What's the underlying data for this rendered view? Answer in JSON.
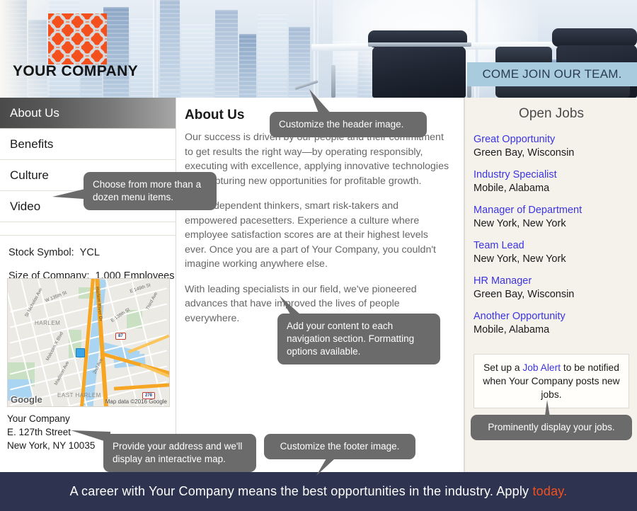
{
  "header": {
    "logo_alt": "company-logo",
    "company_name": "YOUR COMPANY",
    "banner_text": "COME JOIN OUR TEAM."
  },
  "sidebar": {
    "nav": [
      {
        "label": "About Us",
        "active": true
      },
      {
        "label": "Benefits",
        "active": false
      },
      {
        "label": "Culture",
        "active": false
      },
      {
        "label": "Video",
        "active": false
      }
    ],
    "facts": [
      {
        "label": "Stock Symbol:",
        "value": "YCL"
      },
      {
        "label": "Size of Company:",
        "value": "1,000 Employees"
      }
    ],
    "map": {
      "watermark": "Google",
      "attribution": "Map data ©2016 Google",
      "labels": [
        "St Nicholas Ave",
        "W 135th St",
        "HARLEM",
        "Malcolm X Blvd",
        "Madison Ave",
        "2nd Ave",
        "Harlem River Dr",
        "E 149th St",
        "Third Ave",
        "E 138th St",
        "EAST HARLEM"
      ],
      "shields": [
        "87",
        "278"
      ]
    },
    "address": {
      "line1": "Your Company",
      "line2": "E. 127th Street",
      "line3": "New York, NY 10035"
    }
  },
  "main": {
    "title": "About Us",
    "paragraphs": [
      "Our success is driven by our people and their commitment to get results the right way—by operating responsibly, executing with excellence, applying innovative technologies and capturing new opportunities for profitable growth.",
      "Join independent thinkers, smart risk-takers and empowered pacesetters. Experience a culture where employee satisfaction scores are at their highest levels ever. Once you are a part of Your Company, you couldn't imagine working anywhere else.",
      "With leading specialists in our field, we've pioneered advances that have improved the lives of people everywhere."
    ]
  },
  "jobs_panel": {
    "title": "Open Jobs",
    "jobs": [
      {
        "title": "Great Opportunity",
        "location": "Green Bay, Wisconsin"
      },
      {
        "title": "Industry Specialist",
        "location": "Mobile, Alabama"
      },
      {
        "title": "Manager of Department",
        "location": "New York, New York"
      },
      {
        "title": "Team Lead",
        "location": "New York, New York"
      },
      {
        "title": "HR Manager",
        "location": "Green Bay, Wisconsin"
      },
      {
        "title": "Another Opportunity",
        "location": "Mobile, Alabama"
      }
    ],
    "alert": {
      "prefix": "Set up a ",
      "link": "Job Alert",
      "suffix": " to be notified when Your Company posts new jobs."
    }
  },
  "callouts": [
    {
      "id": "header-image",
      "text": "Customize the header image."
    },
    {
      "id": "menu-items",
      "text": "Choose from more than a dozen menu items."
    },
    {
      "id": "content",
      "text": "Add your content to each navigation section.  Formatting options available."
    },
    {
      "id": "jobs",
      "text": "Prominently display your jobs."
    },
    {
      "id": "address-map",
      "text": "Provide your address and we'll display an interactive map."
    },
    {
      "id": "footer-image",
      "text": "Customize the footer image."
    }
  ],
  "footer": {
    "text": "A career with Your Company means the best opportunities in the industry.  Apply ",
    "highlight": "today."
  },
  "colors": {
    "accent_orange": "#f4501e",
    "link_blue": "#3b34e0",
    "footer_navy": "#2e3450",
    "banner_blue": "#a8cbdd",
    "callout_gray": "#6b6b6b",
    "panel_bg": "#f5f2ec"
  }
}
